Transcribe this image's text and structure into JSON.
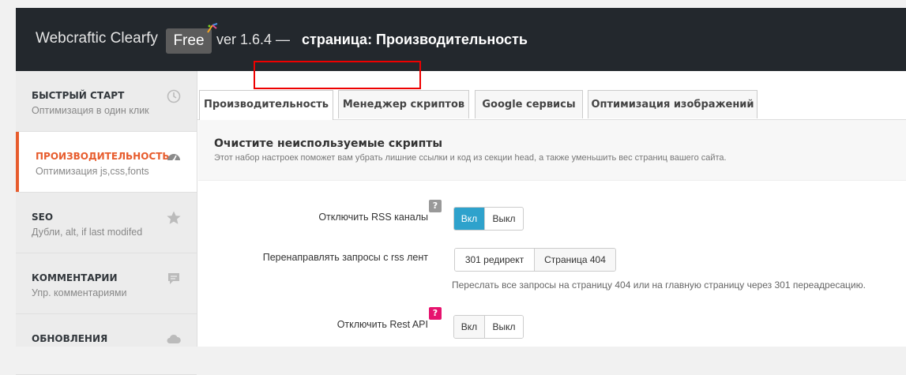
{
  "header": {
    "brand": "Webcraftic Clearfy",
    "badge": "Free",
    "version": "ver 1.6.4 —",
    "page_title": "страница: Производительность"
  },
  "sidebar": {
    "items": [
      {
        "title": "БЫСТРЫЙ СТАРТ",
        "subtitle": "Оптимизация в один клик",
        "icon": "clock-icon"
      },
      {
        "title": "ПРОИЗВОДИТЕЛЬНОСТЬ",
        "subtitle": "Оптимизация js,css,fonts",
        "icon": "dashboard-icon"
      },
      {
        "title": "SEO",
        "subtitle": "Дубли, alt, if last modifed",
        "icon": "star-icon"
      },
      {
        "title": "КОММЕНТАРИИ",
        "subtitle": "Упр. комментариями",
        "icon": "comment-icon"
      },
      {
        "title": "ОБНОВЛЕНИЯ",
        "subtitle": "",
        "icon": "cloud-icon"
      }
    ],
    "active_index": 1
  },
  "tabs": [
    {
      "label": "Производительность"
    },
    {
      "label": "Менеджер скриптов"
    },
    {
      "label": "Google сервисы"
    },
    {
      "label": "Оптимизация изображений"
    }
  ],
  "section": {
    "heading": "Очистите неиспользуемые скрипты",
    "description": "Этот набор настроек поможет вам убрать лишние ссылки и код из секции head, а также уменьшить вес страниц вашего сайта."
  },
  "settings": {
    "rss": {
      "label": "Отключить RSS каналы",
      "help": "?",
      "on": "Вкл",
      "off": "Выкл",
      "value": "Вкл"
    },
    "rss_redirect": {
      "label": "Перенаправлять запросы с rss лент",
      "opt1": "301 редирект",
      "opt2": "Страница 404",
      "value": "301 редирект",
      "hint": "Переслать все запросы на страницу 404 или на главную страницу через 301 переадресацию."
    },
    "rest_api": {
      "label": "Отключить Rest API",
      "help": "?",
      "on": "Вкл",
      "off": "Выкл",
      "value": "Выкл"
    }
  },
  "colors": {
    "accent": "#e75c2d",
    "toggle_on": "#2ea2cc",
    "help_gray": "#999999",
    "help_pink": "#e6136e",
    "annotation": "#ee0000"
  }
}
